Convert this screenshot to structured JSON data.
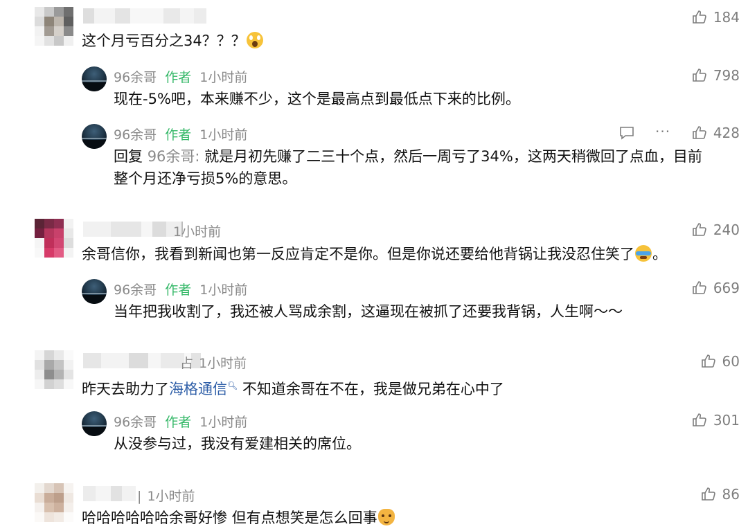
{
  "comments": [
    {
      "time": "",
      "text": "这个月亏百分之34？？？",
      "emoji": "scream-emoji",
      "likes": "184",
      "replies": [
        {
          "author": "96余哥",
          "author_tag": "作者",
          "time": "1小时前",
          "text": "现在-5%吧，本来赚不少，这个是最高点到最低点下来的比例。",
          "likes": "798"
        },
        {
          "author": "96余哥",
          "author_tag": "作者",
          "time": "1小时前",
          "reply_prefix": "回复",
          "reply_to": "96余哥:",
          "text_line1": "就是月初先赚了二三十个点，然后一周亏了34%，这两天稍微回了点血，目前",
          "text_line2": "整个月还净亏损5%的意思。",
          "likes": "428",
          "reply_icon": "comment-icon",
          "more_icon": "more-icon",
          "more_label": "···"
        }
      ]
    },
    {
      "time": "1小时前",
      "text": "余哥信你，我看到新闻也第一反应肯定不是你。但是你说还要给他背锅让我没忍住笑了",
      "text_end": "。",
      "emoji": "crying-laughing-emoji",
      "likes": "240",
      "replies": [
        {
          "author": "96余哥",
          "author_tag": "作者",
          "time": "1小时前",
          "text": "当年把我收割了，我还被人骂成余割，这逼现在被抓了还要我背锅，人生啊～～",
          "likes": "669"
        }
      ]
    },
    {
      "name_fragment": "占",
      "time": "1小时前",
      "text_before": "昨天去助力了",
      "link": "海格通信",
      "text_after": " 不知道余哥在不在，我是做兄弟在心中了",
      "likes": "60",
      "replies": [
        {
          "author": "96余哥",
          "author_tag": "作者",
          "time": "1小时前",
          "text": "从没参与过，我没有爱建相关的席位。",
          "likes": "301"
        }
      ]
    },
    {
      "name_fragment": "|",
      "time": "1小时前",
      "text": "哈哈哈哈哈哈余哥好惨 但有点想笑是怎么回事",
      "emoji": "cat-emoji",
      "likes": "86"
    }
  ],
  "icons": {
    "like": "thumbs-up-icon",
    "search": "search-icon"
  }
}
